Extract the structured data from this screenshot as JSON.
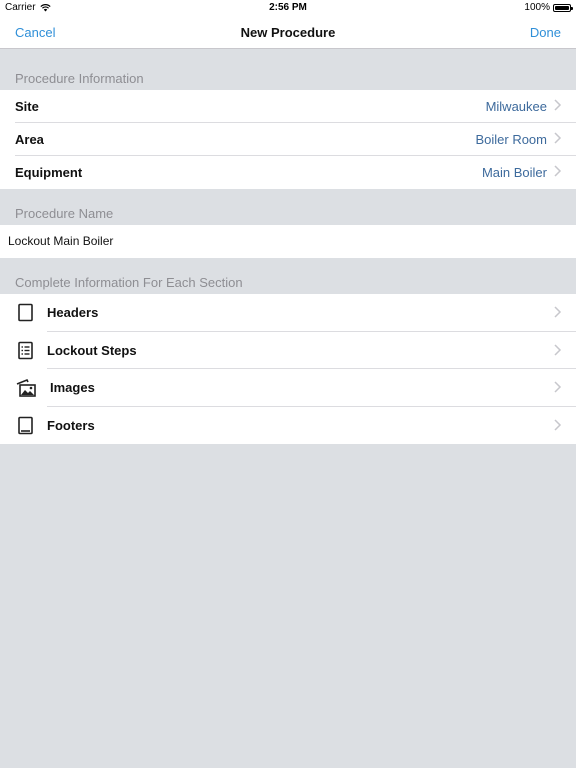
{
  "status_bar": {
    "carrier": "Carrier",
    "time": "2:56 PM",
    "battery_percent": "100%"
  },
  "nav": {
    "cancel_label": "Cancel",
    "title": "New Procedure",
    "done_label": "Done"
  },
  "procedure_info": {
    "header": "Procedure Information",
    "rows": [
      {
        "label": "Site",
        "value": "Milwaukee"
      },
      {
        "label": "Area",
        "value": "Boiler Room"
      },
      {
        "label": "Equipment",
        "value": "Main Boiler"
      }
    ]
  },
  "procedure_name": {
    "header": "Procedure Name",
    "value": "Lockout Main Boiler"
  },
  "sections": {
    "header": "Complete Information For Each Section",
    "items": [
      {
        "label": "Headers",
        "icon": "document-icon"
      },
      {
        "label": "Lockout Steps",
        "icon": "list-icon"
      },
      {
        "label": "Images",
        "icon": "image-icon"
      },
      {
        "label": "Footers",
        "icon": "footer-doc-icon"
      }
    ]
  },
  "colors": {
    "accent": "#2f8fd8",
    "value_text": "#3d6a9c",
    "background": "#dcdfe3"
  }
}
